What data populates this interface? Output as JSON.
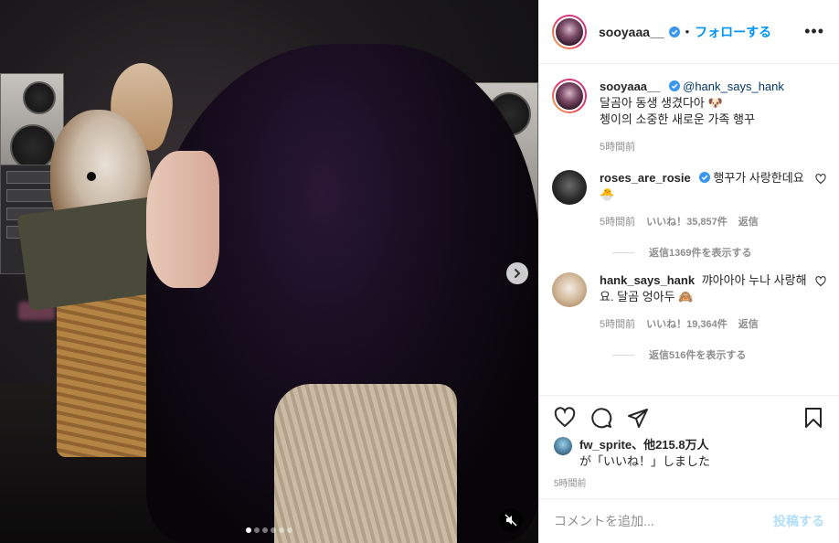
{
  "media": {
    "carousel_dots": 6,
    "active_dot": 0,
    "next_button_icon": "chevron-right-icon",
    "mute_icon": "speaker-muted-icon"
  },
  "header": {
    "username": "sooyaaa__",
    "verified": true,
    "separator": "•",
    "follow_label": "フォローする",
    "more_icon": "more-options-icon",
    "more_label": "•••"
  },
  "caption": {
    "username": "sooyaaa__",
    "mention": "@hank_says_hank",
    "line1": "달곰아 동생 생겼다아 🐶",
    "line2": "쳉이의 소중한 새로운 가족 행꾸",
    "time": "5時間前"
  },
  "comments": [
    {
      "username": "roses_are_rosie",
      "verified": true,
      "text": "행꾸가 사랑한데요 🐣",
      "time": "5時間前",
      "likes_label": "いいね！35,857件",
      "reply_label": "返信",
      "view_replies": "返信1369件を表示する"
    },
    {
      "username": "hank_says_hank",
      "verified": false,
      "text": "꺄아아아 누나 사랑해요. 달곰 엉아두 🙈",
      "time": "5時間前",
      "likes_label": "いいね！19,364件",
      "reply_label": "返信",
      "view_replies": "返信516件を表示する"
    }
  ],
  "likes": {
    "user": "fw_sprite",
    "rest": "、他215.8万人",
    "suffix": "が「いいね！」しました"
  },
  "post_time": "5時間前",
  "add_comment": {
    "placeholder": "コメントを追加...",
    "post_label": "投稿する"
  },
  "colors": {
    "accent": "#0095f6",
    "verified": "#3897f0",
    "muted_text": "#8e8e8e",
    "post_disabled": "#b2dffc"
  }
}
